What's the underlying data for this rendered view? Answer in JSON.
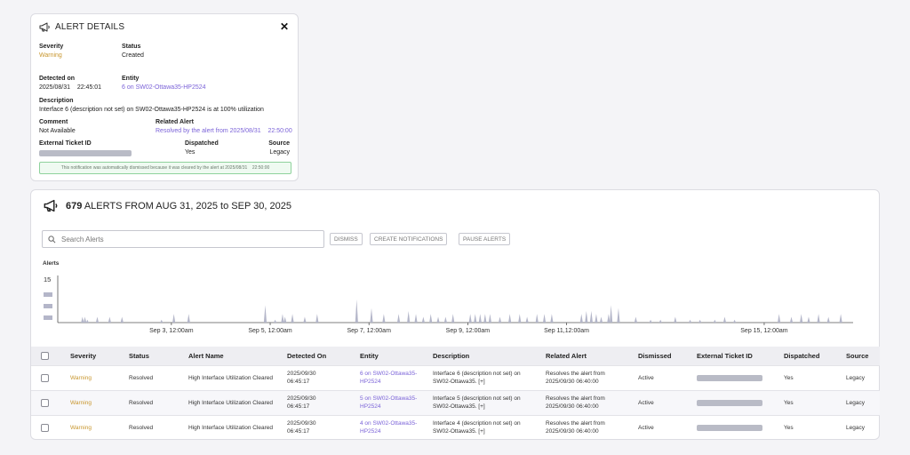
{
  "details": {
    "title": "ALERT DETAILS",
    "close_glyph": "✕",
    "severity": {
      "label": "Severity",
      "value": "Warning"
    },
    "status": {
      "label": "Status",
      "value": "Created"
    },
    "detected_on": {
      "label": "Detected on",
      "value": "2025/08/31    22:45:01"
    },
    "entity": {
      "label": "Entity",
      "value": "6 on SW02-Ottawa35-HP2524"
    },
    "description": {
      "label": "Description",
      "value": "Interface 6 (description not set) on SW02-Ottawa35-HP2524 is at 100% utilization"
    },
    "comment": {
      "label": "Comment",
      "value": "Not Available"
    },
    "related_alert": {
      "label": "Related Alert",
      "value": "Resolved by the alert from 2025/08/31    22:50:00"
    },
    "external_ticket": {
      "label": "External Ticket ID"
    },
    "dispatched": {
      "label": "Dispatched",
      "value": "Yes"
    },
    "source": {
      "label": "Source",
      "value": "Legacy"
    },
    "note": "This notification was automatically dismissed because it was cleared by the alert at 2025/08/31    22:50:00"
  },
  "alerts": {
    "count": "679",
    "title_rest": "ALERTS FROM AUG 31, 2025 to SEP 30, 2025",
    "search_placeholder": "Search Alerts",
    "buttons": {
      "dismiss": "DISMISS",
      "create": "CREATE NOTIFICATIONS",
      "pause": "PAUSE ALERTS"
    },
    "chart_label": "Alerts"
  },
  "chart_data": {
    "type": "area",
    "title": "",
    "ylabel": "Alerts",
    "yticks": [
      "15"
    ],
    "ylim": [
      0,
      15
    ],
    "x_ticks": [
      "Sep 3, 12:00am",
      "Sep 5, 12:00am",
      "Sep 7, 12:00am",
      "Sep 9, 12:00am",
      "Sep 11,12:00am",
      "Sep 15, 12:00am"
    ],
    "x_tick_days": [
      2.5,
      4.5,
      6.5,
      8.5,
      10.5,
      14.5
    ],
    "xlim_days": [
      0.5,
      15.5
    ],
    "spikes": [
      [
        1.0,
        2
      ],
      [
        1.05,
        2
      ],
      [
        1.1,
        1
      ],
      [
        1.3,
        2
      ],
      [
        1.55,
        2
      ],
      [
        1.8,
        2
      ],
      [
        2.6,
        1
      ],
      [
        2.85,
        3
      ],
      [
        3.15,
        3
      ],
      [
        4.7,
        6
      ],
      [
        4.9,
        1
      ],
      [
        5.05,
        3
      ],
      [
        5.1,
        2
      ],
      [
        5.25,
        3
      ],
      [
        5.5,
        2
      ],
      [
        5.75,
        3
      ],
      [
        6.55,
        8
      ],
      [
        6.85,
        5
      ],
      [
        7.1,
        3
      ],
      [
        7.4,
        3
      ],
      [
        7.6,
        4
      ],
      [
        7.75,
        3
      ],
      [
        7.9,
        2
      ],
      [
        8.05,
        3
      ],
      [
        8.2,
        2
      ],
      [
        8.35,
        2
      ],
      [
        8.5,
        3
      ],
      [
        8.85,
        3
      ],
      [
        8.95,
        3
      ],
      [
        9.05,
        3
      ],
      [
        9.15,
        3
      ],
      [
        9.25,
        3
      ],
      [
        9.45,
        2
      ],
      [
        9.65,
        3
      ],
      [
        9.85,
        3
      ],
      [
        10.0,
        2
      ],
      [
        10.2,
        3
      ],
      [
        10.35,
        3
      ],
      [
        10.5,
        3
      ],
      [
        11.1,
        3
      ],
      [
        11.2,
        4
      ],
      [
        11.3,
        4
      ],
      [
        11.4,
        3
      ],
      [
        11.5,
        2
      ],
      [
        11.65,
        3
      ],
      [
        11.7,
        6
      ],
      [
        11.85,
        5
      ],
      [
        12.2,
        2
      ],
      [
        12.5,
        1
      ],
      [
        12.7,
        1
      ],
      [
        13.0,
        2
      ],
      [
        13.3,
        1
      ],
      [
        13.5,
        1
      ],
      [
        13.8,
        1
      ],
      [
        14.0,
        2
      ],
      [
        14.2,
        1
      ],
      [
        15.1,
        3
      ],
      [
        15.35,
        2
      ],
      [
        15.55,
        3
      ],
      [
        15.7,
        2
      ],
      [
        15.9,
        3
      ],
      [
        16.1,
        2
      ],
      [
        16.35,
        3
      ]
    ]
  },
  "table": {
    "headers": [
      "Severity",
      "Status",
      "Alert Name",
      "Detected On",
      "Entity",
      "Description",
      "Related Alert",
      "Dismissed",
      "External Ticket ID",
      "Dispatched",
      "Source"
    ],
    "rows": [
      {
        "severity": "Warning",
        "status": "Resolved",
        "alert_name": "High Interface Utilization Cleared",
        "detected_on": "2025/09/30 06:45:17",
        "entity": "6 on SW02-Ottawa35-HP2524",
        "description": "Interface 6 (description not set) on SW02-Ottawa35. [+]",
        "related": "Resolves the alert from 2025/09/30 06:40:00",
        "dismissed": "Active",
        "dispatched": "Yes",
        "source": "Legacy"
      },
      {
        "severity": "Warning",
        "status": "Resolved",
        "alert_name": "High Interface Utilization Cleared",
        "detected_on": "2025/09/30 06:45:17",
        "entity": "5 on SW02-Ottawa35-HP2524",
        "description": "Interface 5 (description not set) on SW02-Ottawa35. [+]",
        "related": "Resolves the alert from 2025/09/30 06:40:00",
        "dismissed": "Active",
        "dispatched": "Yes",
        "source": "Legacy"
      },
      {
        "severity": "Warning",
        "status": "Resolved",
        "alert_name": "High Interface Utilization Cleared",
        "detected_on": "2025/09/30 06:45:17",
        "entity": "4 on SW02-Ottawa35-HP2524",
        "description": "Interface 4 (description not set) on SW02-Ottawa35. [+]",
        "related": "Resolves the alert from 2025/09/30 06:40:00",
        "dismissed": "Active",
        "dispatched": "Yes",
        "source": "Legacy"
      }
    ]
  },
  "colors": {
    "warning": "#c8962d",
    "link": "#7b63d8",
    "chart_fill": "#b4b6c9"
  }
}
